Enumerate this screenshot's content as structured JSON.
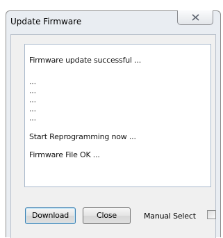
{
  "window": {
    "title": "Update Firmware"
  },
  "log": {
    "lines": [
      "Firmware update successful ...",
      "...",
      "...",
      "...",
      "...",
      "...",
      "Start Reprogramming now ...",
      "Firmware File OK ..."
    ]
  },
  "buttons": {
    "download_label": "Download",
    "close_label": "Close"
  },
  "manual_select": {
    "label": "Manual Select",
    "checked": false
  },
  "icons": {
    "titlebar_close": "close-x-icon"
  }
}
